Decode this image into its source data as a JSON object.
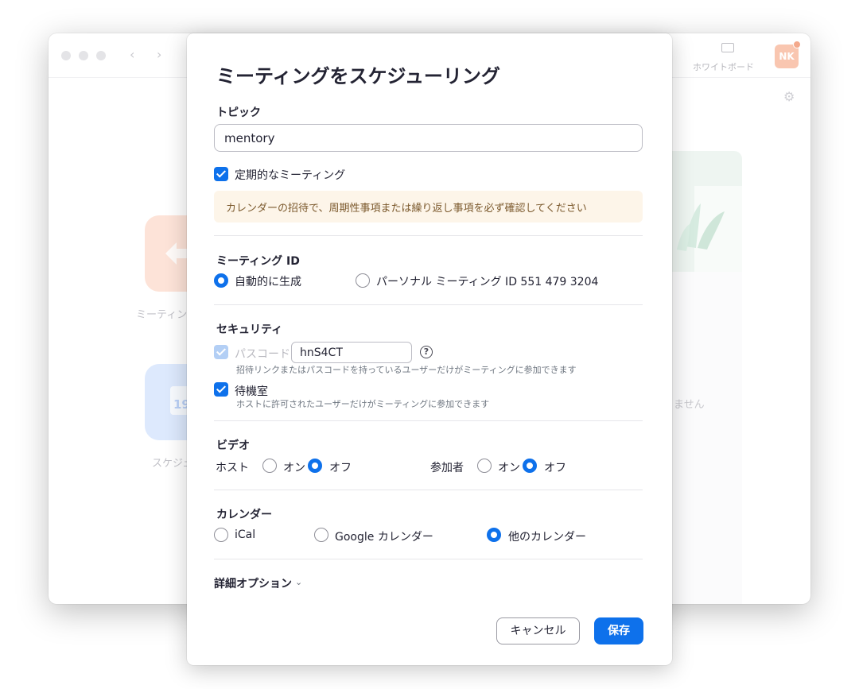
{
  "background_window": {
    "whiteboard_label": "ホワイトボード",
    "avatar_initials": "NK",
    "tile_label_meeting": "ミーティン",
    "tile_label_schedule": "スケジュ",
    "tile_blue_date": "19",
    "right_text": "ません"
  },
  "dialog": {
    "title": "ミーティングをスケジューリング",
    "topic": {
      "label": "トピック",
      "value": "mentory"
    },
    "recurring": {
      "label": "定期的なミーティング",
      "checked": true
    },
    "notice": "カレンダーの招待で、周期性事項または繰り返し事項を必ず確認してください",
    "meeting_id": {
      "label": "ミーティング ID",
      "options": [
        {
          "label": "自動的に生成",
          "selected": true
        },
        {
          "label": "パーソナル ミーティング ID 551 479 3204",
          "selected": false
        }
      ]
    },
    "security": {
      "label": "セキュリティ",
      "passcode": {
        "label": "パスコード",
        "value": "hnS4CT",
        "checked": true,
        "disabled": true,
        "help": "招待リンクまたはパスコードを持っているユーザーだけがミーティングに参加できます"
      },
      "waiting_room": {
        "label": "待機室",
        "checked": true,
        "help": "ホストに許可されたユーザーだけがミーティングに参加できます"
      }
    },
    "video": {
      "label": "ビデオ",
      "host": {
        "label": "ホスト",
        "on": "オン",
        "off": "オフ",
        "selected": "off"
      },
      "participants": {
        "label": "参加者",
        "on": "オン",
        "off": "オフ",
        "selected": "off"
      }
    },
    "calendar": {
      "label": "カレンダー",
      "options": [
        {
          "label": "iCal",
          "selected": false
        },
        {
          "label": "Google カレンダー",
          "selected": false
        },
        {
          "label": "他のカレンダー",
          "selected": true
        }
      ]
    },
    "advanced_options": "詳細オプション",
    "buttons": {
      "cancel": "キャンセル",
      "save": "保存"
    }
  },
  "colors": {
    "accent": "#0e71eb",
    "notice_bg": "#fdf5e9",
    "notice_text": "#7c5a2e"
  }
}
